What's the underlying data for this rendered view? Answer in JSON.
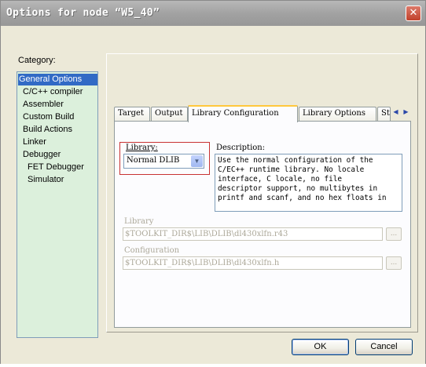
{
  "window": {
    "title": "Options for node “W5_40”",
    "close_glyph": "✕"
  },
  "category": {
    "label": "Category:",
    "items": [
      {
        "label": "General Options",
        "selected": true
      },
      {
        "label": "C/C++ compiler"
      },
      {
        "label": "Assembler"
      },
      {
        "label": "Custom Build"
      },
      {
        "label": "Build Actions"
      },
      {
        "label": "Linker"
      },
      {
        "label": "Debugger"
      },
      {
        "label": "FET Debugger"
      },
      {
        "label": "Simulator"
      }
    ]
  },
  "tabs": [
    {
      "label": "Target"
    },
    {
      "label": "Output"
    },
    {
      "label": "Library Configuration",
      "active": true
    },
    {
      "label": "Library Options"
    },
    {
      "label": "St"
    }
  ],
  "tab_scroll": {
    "left_icon": "triangle-left-icon",
    "right_icon": "triangle-right-icon",
    "left_glyph": "◀",
    "right_glyph": "▶"
  },
  "library": {
    "label": "Library:",
    "value": "Normal DLIB",
    "arrow_glyph": "▼"
  },
  "description": {
    "label": "Description:",
    "text": "Use the normal configuration of the\nC/EC++ runtime library. No locale\ninterface, C locale, no file\ndescriptor support, no multibytes in\nprintf and scanf, and no hex floats in"
  },
  "library_file": {
    "label": "Library",
    "value": "$TOOLKIT_DIR$\\LIB\\DLIB\\dl430xlfn.r43",
    "browse_label": "..."
  },
  "configuration_file": {
    "label": "Configuration",
    "value": "$TOOLKIT_DIR$\\LIB\\DLIB\\dl430xlfn.h",
    "browse_label": "..."
  },
  "buttons": {
    "ok": "OK",
    "cancel": "Cancel"
  },
  "colors": {
    "titlebar": "#a2a2a2",
    "category_list_bg": "#dcf0dc",
    "selection": "#316ac5",
    "active_tab_accent": "#ffc83c",
    "library_highlight_border": "#c83232"
  }
}
